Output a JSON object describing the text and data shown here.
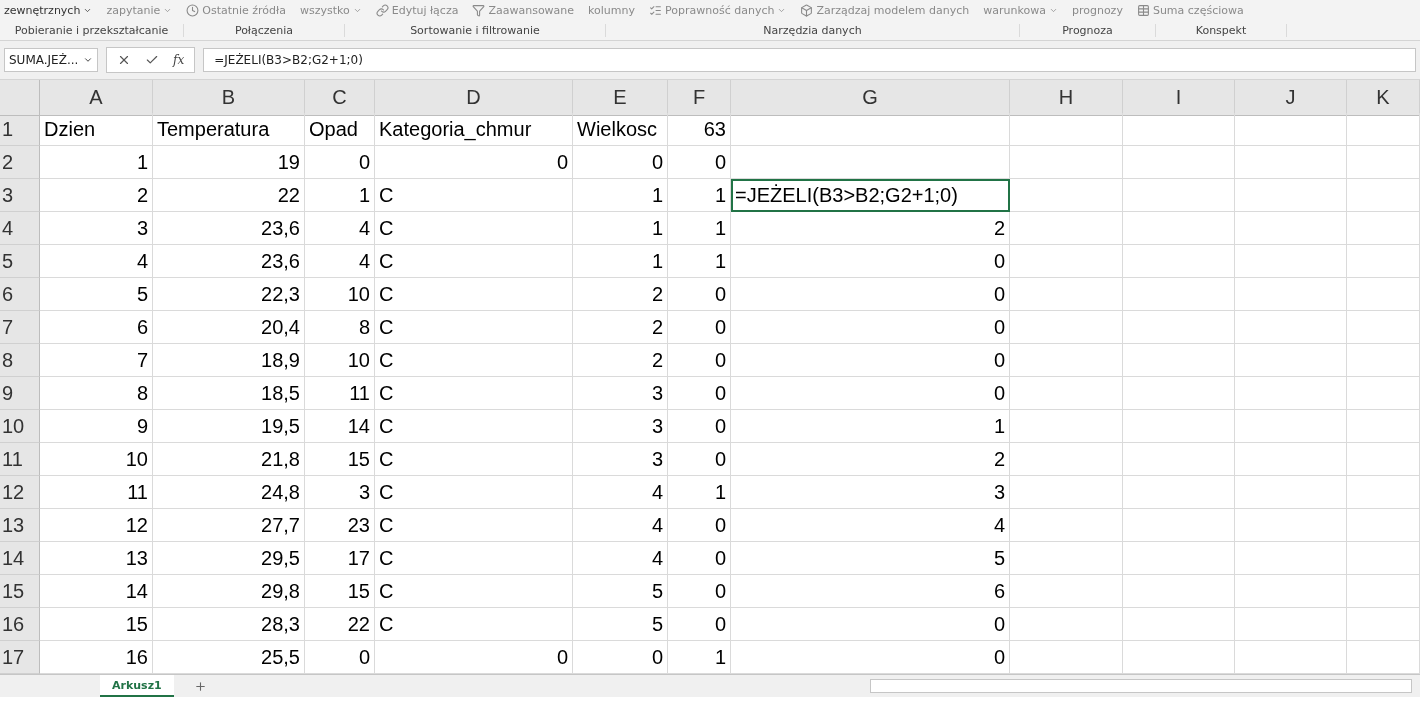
{
  "ribbon": {
    "items": [
      {
        "label": "zewnętrznych",
        "caret": true,
        "dim": false
      },
      {
        "label": "zapytanie",
        "caret": true,
        "dim": true
      },
      {
        "label": "Ostatnie źródła",
        "caret": false,
        "dim": true
      },
      {
        "label": "wszystko",
        "caret": true,
        "dim": true
      },
      {
        "label": "Edytuj łącza",
        "caret": false,
        "dim": true
      },
      {
        "label": "Zaawansowane",
        "caret": false,
        "dim": true
      },
      {
        "label": "kolumny",
        "caret": false,
        "dim": true
      },
      {
        "label": "Poprawność danych",
        "caret": true,
        "dim": true
      },
      {
        "label": "Zarządzaj modelem danych",
        "caret": false,
        "dim": true
      },
      {
        "label": "warunkowa",
        "caret": true,
        "dim": true
      },
      {
        "label": "prognozy",
        "caret": false,
        "dim": true
      },
      {
        "label": "Suma częściowa",
        "caret": false,
        "dim": true
      }
    ],
    "groups": [
      "Pobieranie i przekształcanie",
      "Połączenia",
      "Sortowanie i filtrowanie",
      "Narzędzia danych",
      "Prognoza",
      "Konspekt"
    ]
  },
  "formula_bar": {
    "name_box": "SUMA.JEŻ...",
    "fx": "fx",
    "formula": "=JEŻELI(B3>B2;G2+1;0)"
  },
  "sheet": {
    "columns": [
      "A",
      "B",
      "C",
      "D",
      "E",
      "F",
      "G",
      "H",
      "I",
      "J",
      "K"
    ],
    "rows": [
      {
        "header": "1",
        "cells": [
          {
            "value": "Dzien",
            "kind": "text"
          },
          {
            "value": "Temperatura",
            "kind": "text"
          },
          {
            "value": "Opad",
            "kind": "text"
          },
          {
            "value": "Kategoria_chmur",
            "kind": "text"
          },
          {
            "value": "Wielkosc",
            "kind": "text"
          },
          {
            "value": "63",
            "kind": "number"
          },
          null
        ]
      },
      {
        "header": "2",
        "cells": [
          {
            "value": "1",
            "kind": "number"
          },
          {
            "value": "19",
            "kind": "number"
          },
          {
            "value": "0",
            "kind": "number"
          },
          {
            "value": "0",
            "kind": "number"
          },
          {
            "value": "0",
            "kind": "number"
          },
          {
            "value": "0",
            "kind": "number"
          },
          null
        ]
      },
      {
        "header": "3",
        "cells": [
          {
            "value": "2",
            "kind": "number"
          },
          {
            "value": "22",
            "kind": "number"
          },
          {
            "value": "1",
            "kind": "number"
          },
          {
            "value": "C",
            "kind": "text"
          },
          {
            "value": "1",
            "kind": "number"
          },
          {
            "value": "1",
            "kind": "number"
          },
          {
            "value": "=JEŻELI(B3>B2;G2+1;0)",
            "kind": "editing"
          }
        ]
      },
      {
        "header": "4",
        "cells": [
          {
            "value": "3",
            "kind": "number"
          },
          {
            "value": "23,6",
            "kind": "number"
          },
          {
            "value": "4",
            "kind": "number"
          },
          {
            "value": "C",
            "kind": "text"
          },
          {
            "value": "1",
            "kind": "number"
          },
          {
            "value": "1",
            "kind": "number"
          },
          {
            "value": "2",
            "kind": "number"
          }
        ]
      },
      {
        "header": "5",
        "cells": [
          {
            "value": "4",
            "kind": "number"
          },
          {
            "value": "23,6",
            "kind": "number"
          },
          {
            "value": "4",
            "kind": "number"
          },
          {
            "value": "C",
            "kind": "text"
          },
          {
            "value": "1",
            "kind": "number"
          },
          {
            "value": "1",
            "kind": "number"
          },
          {
            "value": "0",
            "kind": "number"
          }
        ]
      },
      {
        "header": "6",
        "cells": [
          {
            "value": "5",
            "kind": "number"
          },
          {
            "value": "22,3",
            "kind": "number"
          },
          {
            "value": "10",
            "kind": "number"
          },
          {
            "value": "C",
            "kind": "text"
          },
          {
            "value": "2",
            "kind": "number"
          },
          {
            "value": "0",
            "kind": "number"
          },
          {
            "value": "0",
            "kind": "number"
          }
        ]
      },
      {
        "header": "7",
        "cells": [
          {
            "value": "6",
            "kind": "number"
          },
          {
            "value": "20,4",
            "kind": "number"
          },
          {
            "value": "8",
            "kind": "number"
          },
          {
            "value": "C",
            "kind": "text"
          },
          {
            "value": "2",
            "kind": "number"
          },
          {
            "value": "0",
            "kind": "number"
          },
          {
            "value": "0",
            "kind": "number"
          }
        ]
      },
      {
        "header": "8",
        "cells": [
          {
            "value": "7",
            "kind": "number"
          },
          {
            "value": "18,9",
            "kind": "number"
          },
          {
            "value": "10",
            "kind": "number"
          },
          {
            "value": "C",
            "kind": "text"
          },
          {
            "value": "2",
            "kind": "number"
          },
          {
            "value": "0",
            "kind": "number"
          },
          {
            "value": "0",
            "kind": "number"
          }
        ]
      },
      {
        "header": "9",
        "cells": [
          {
            "value": "8",
            "kind": "number"
          },
          {
            "value": "18,5",
            "kind": "number"
          },
          {
            "value": "11",
            "kind": "number"
          },
          {
            "value": "C",
            "kind": "text"
          },
          {
            "value": "3",
            "kind": "number"
          },
          {
            "value": "0",
            "kind": "number"
          },
          {
            "value": "0",
            "kind": "number"
          }
        ]
      },
      {
        "header": "10",
        "cells": [
          {
            "value": "9",
            "kind": "number"
          },
          {
            "value": "19,5",
            "kind": "number"
          },
          {
            "value": "14",
            "kind": "number"
          },
          {
            "value": "C",
            "kind": "text"
          },
          {
            "value": "3",
            "kind": "number"
          },
          {
            "value": "0",
            "kind": "number"
          },
          {
            "value": "1",
            "kind": "number"
          }
        ]
      },
      {
        "header": "11",
        "cells": [
          {
            "value": "10",
            "kind": "number"
          },
          {
            "value": "21,8",
            "kind": "number"
          },
          {
            "value": "15",
            "kind": "number"
          },
          {
            "value": "C",
            "kind": "text"
          },
          {
            "value": "3",
            "kind": "number"
          },
          {
            "value": "0",
            "kind": "number"
          },
          {
            "value": "2",
            "kind": "number"
          }
        ]
      },
      {
        "header": "12",
        "cells": [
          {
            "value": "11",
            "kind": "number"
          },
          {
            "value": "24,8",
            "kind": "number"
          },
          {
            "value": "3",
            "kind": "number"
          },
          {
            "value": "C",
            "kind": "text"
          },
          {
            "value": "4",
            "kind": "number"
          },
          {
            "value": "1",
            "kind": "number"
          },
          {
            "value": "3",
            "kind": "number"
          }
        ]
      },
      {
        "header": "13",
        "cells": [
          {
            "value": "12",
            "kind": "number"
          },
          {
            "value": "27,7",
            "kind": "number"
          },
          {
            "value": "23",
            "kind": "number"
          },
          {
            "value": "C",
            "kind": "text"
          },
          {
            "value": "4",
            "kind": "number"
          },
          {
            "value": "0",
            "kind": "number"
          },
          {
            "value": "4",
            "kind": "number"
          }
        ]
      },
      {
        "header": "14",
        "cells": [
          {
            "value": "13",
            "kind": "number"
          },
          {
            "value": "29,5",
            "kind": "number"
          },
          {
            "value": "17",
            "kind": "number"
          },
          {
            "value": "C",
            "kind": "text"
          },
          {
            "value": "4",
            "kind": "number"
          },
          {
            "value": "0",
            "kind": "number"
          },
          {
            "value": "5",
            "kind": "number"
          }
        ]
      },
      {
        "header": "15",
        "cells": [
          {
            "value": "14",
            "kind": "number"
          },
          {
            "value": "29,8",
            "kind": "number"
          },
          {
            "value": "15",
            "kind": "number"
          },
          {
            "value": "C",
            "kind": "text"
          },
          {
            "value": "5",
            "kind": "number"
          },
          {
            "value": "0",
            "kind": "number"
          },
          {
            "value": "6",
            "kind": "number"
          }
        ]
      },
      {
        "header": "16",
        "cells": [
          {
            "value": "15",
            "kind": "number"
          },
          {
            "value": "28,3",
            "kind": "number"
          },
          {
            "value": "22",
            "kind": "number"
          },
          {
            "value": "C",
            "kind": "text"
          },
          {
            "value": "5",
            "kind": "number"
          },
          {
            "value": "0",
            "kind": "number"
          },
          {
            "value": "0",
            "kind": "number"
          }
        ]
      },
      {
        "header": "17",
        "cells": [
          {
            "value": "16",
            "kind": "number"
          },
          {
            "value": "25,5",
            "kind": "number"
          },
          {
            "value": "0",
            "kind": "number"
          },
          {
            "value": "0",
            "kind": "number"
          },
          {
            "value": "0",
            "kind": "number"
          },
          {
            "value": "1",
            "kind": "number"
          },
          {
            "value": "0",
            "kind": "number"
          }
        ]
      }
    ]
  },
  "sheet_tabs": [
    {
      "label": "Arkusz1",
      "selected": true
    }
  ]
}
